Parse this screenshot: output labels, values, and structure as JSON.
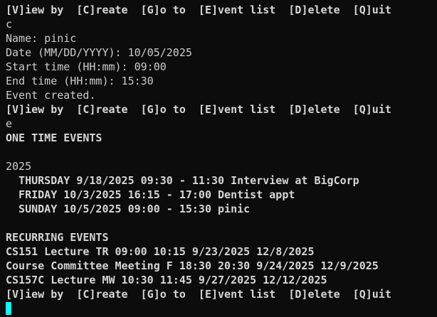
{
  "terminal": {
    "lines": [
      {
        "text": "[V]iew by  [C]reate  [G]o to  [E]vent list  [D]elete  [Q]uit",
        "kind": "menu"
      },
      {
        "text": "c",
        "kind": "input"
      },
      {
        "text": "Name: pinic",
        "kind": "output"
      },
      {
        "text": "Date (MM/DD/YYYY): 10/05/2025",
        "kind": "output"
      },
      {
        "text": "Start time (HH:mm): 09:00",
        "kind": "output"
      },
      {
        "text": "End time (HH:mm): 15:30",
        "kind": "output"
      },
      {
        "text": "Event created.",
        "kind": "output"
      },
      {
        "text": "[V]iew by  [C]reate  [G]o to  [E]vent list  [D]elete  [Q]uit",
        "kind": "menu"
      },
      {
        "text": "e",
        "kind": "input"
      },
      {
        "text": "ONE TIME EVENTS",
        "kind": "heading"
      },
      {
        "text": "",
        "kind": "blank"
      },
      {
        "text": "2025",
        "kind": "output"
      },
      {
        "text": "  THURSDAY 9/18/2025 09:30 - 11:30 Interview at BigCorp",
        "kind": "event"
      },
      {
        "text": "  FRIDAY 10/3/2025 16:15 - 17:00 Dentist appt",
        "kind": "event"
      },
      {
        "text": "  SUNDAY 10/5/2025 09:00 - 15:30 pinic",
        "kind": "event"
      },
      {
        "text": "",
        "kind": "blank"
      },
      {
        "text": "RECURRING EVENTS",
        "kind": "heading"
      },
      {
        "text": "CS151 Lecture TR 09:00 10:15 9/23/2025 12/8/2025",
        "kind": "event"
      },
      {
        "text": "Course Committee Meeting F 18:30 20:30 9/24/2025 12/9/2025",
        "kind": "event"
      },
      {
        "text": "CS157C Lecture MW 10:30 11:45 9/27/2025 12/12/2025",
        "kind": "event"
      },
      {
        "text": "[V]iew by  [C]reate  [G]o to  [E]vent list  [D]elete  [Q]uit",
        "kind": "menu"
      }
    ],
    "cursor_color": "#00ffff",
    "background_color": "#0c0c0c",
    "text_color": "#cccccc"
  }
}
